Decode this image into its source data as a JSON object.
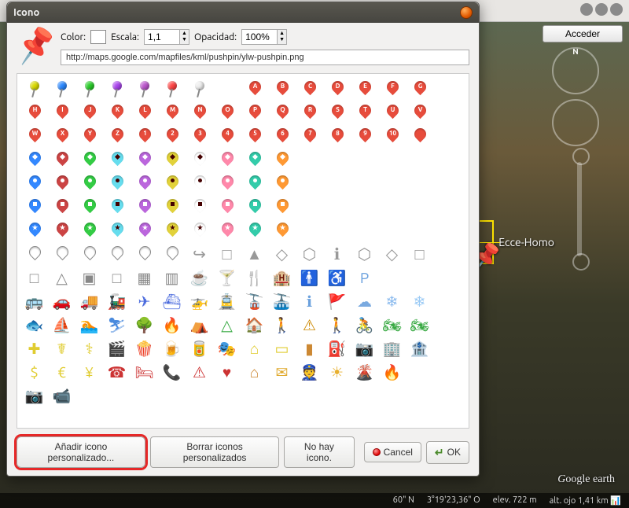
{
  "dialog": {
    "title": "Icono",
    "color_label": "Color:",
    "scale_label": "Escala:",
    "scale_value": "1,1",
    "opacity_label": "Opacidad:",
    "opacity_value": "100%",
    "url_value": "http://maps.google.com/mapfiles/kml/pushpin/ylw-pushpin.png",
    "btn_add_custom": "Añadir icono personalizado...",
    "btn_delete_custom": "Borrar iconos personalizados",
    "btn_no_icon": "No hay icono.",
    "btn_cancel": "Cancel",
    "btn_ok": "OK"
  },
  "icons": {
    "pushpin_colors": [
      "#dada00",
      "#2a88ff",
      "#28cc28",
      "#aa44ee",
      "#bb55cc",
      "#ff4444",
      "#eeeeee"
    ],
    "marker_letters_r1": [
      "A",
      "B",
      "C",
      "D",
      "E",
      "F",
      "G"
    ],
    "marker_letters_r2": [
      "H",
      "I",
      "J",
      "K",
      "L",
      "M",
      "N",
      "O",
      "P",
      "Q",
      "R",
      "S",
      "T",
      "U",
      "V"
    ],
    "marker_letters_r3": [
      "W",
      "X",
      "Y",
      "Z",
      "1",
      "2",
      "3",
      "4",
      "5",
      "6",
      "7",
      "8",
      "9",
      "10",
      ""
    ],
    "paddle_colors": [
      "#3388ff",
      "#cc4444",
      "#33cc44",
      "#66ddee",
      "#bb66dd",
      "#e2d23a",
      "#ffffff",
      "#ff88aa",
      "#33ccaa",
      "#ff9933"
    ],
    "paddle_shapes": [
      "diamond",
      "dot",
      "square",
      "star"
    ],
    "gray_symbols": [
      "↪",
      "□",
      "▲",
      "◇",
      "⬡",
      "ℹ",
      "⬡",
      "◇",
      "□"
    ],
    "poi_row1": [
      "□",
      "△",
      "▣",
      "□",
      "▦",
      "▥",
      "☕",
      "🍸",
      "🍴",
      "🏨",
      "🚹",
      "♿",
      "P"
    ],
    "poi_row2": [
      "🚌",
      "🚗",
      "🚚",
      "🚂",
      "✈",
      "⛴",
      "🚁",
      "🚊",
      "🚡",
      "🚠",
      "ℹ",
      "🚩",
      "☁",
      "❄",
      "❄"
    ],
    "poi_row3": [
      "🐟",
      "⛵",
      "🏊",
      "⛷",
      "🌳",
      "🔥",
      "⛺",
      "△",
      "🏠",
      "🚶",
      "⚠",
      "🚶",
      "🚴",
      "🏍",
      "🏍"
    ],
    "poi_row4": [
      "✚",
      "☤",
      "⚕",
      "🎬",
      "🍿",
      "🍺",
      "🥫",
      "🎭",
      "⌂",
      "▭",
      "▮",
      "⛽",
      "📷",
      "🏢",
      "🏦"
    ],
    "poi_row5": [
      "$",
      "€",
      "¥",
      "☎",
      "🛏",
      "📞",
      "⚠",
      "♥",
      "⌂",
      "✉",
      "👮",
      "☀",
      "🌋",
      "🔥"
    ],
    "poi_row6": [
      "📷",
      "📹"
    ],
    "poi_colors": {
      "row1": [
        "#888",
        "#888",
        "#888",
        "#888",
        "#888",
        "#888",
        "#6aa0dd",
        "#6aa0dd",
        "#6aa0dd",
        "#6aa0dd",
        "#6aa0dd",
        "#6aa0dd",
        "#6aa0dd"
      ],
      "row2": [
        "#4a6add",
        "#4a6add",
        "#4a6add",
        "#4a6add",
        "#4a6add",
        "#4a6add",
        "#4a6add",
        "#4a6add",
        "#4a6add",
        "#4a6add",
        "#6aa0dd",
        "#6aa0dd",
        "#7aaae0",
        "#8abaee",
        "#9acaf5"
      ],
      "row3": [
        "#3a8add",
        "#4a8add",
        "#4a8add",
        "#4a8add",
        "#3aaa44",
        "#3aaa44",
        "#3aaa44",
        "#3aaa44",
        "#3aaa44",
        "#3aaa44",
        "#cc8800",
        "#3aaa44",
        "#3aaa44",
        "#3aaa44",
        "#3aaa44"
      ],
      "row4": [
        "#e0cc30",
        "#e0cc30",
        "#e0cc30",
        "#e0cc30",
        "#e0cc30",
        "#e0cc30",
        "#e0cc30",
        "#e0cc30",
        "#e0cc30",
        "#e0cc30",
        "#cc8833",
        "#e0cc30",
        "#e0cc30",
        "#888",
        "#888"
      ],
      "row5": [
        "#e0cc30",
        "#e0cc30",
        "#e0cc30",
        "#cc3333",
        "#cc3333",
        "#cc3333",
        "#cc3333",
        "#cc3333",
        "#cc8833",
        "#e0aa30",
        "#4a6add",
        "#e8b030",
        "#aa4a20",
        "#dd6622"
      ],
      "row6": [
        "#cc7733",
        "#cc7733"
      ]
    }
  },
  "earth": {
    "acceder": "Acceder",
    "placemark_label": "Ecce-Homo",
    "logo": "Google earth",
    "status": {
      "lat": "60\" N",
      "lon": "3°19'23,36\" O",
      "elev_label": "elev.",
      "elev": "722 m",
      "eye_label": "alt. ojo",
      "eye": "1,41 km"
    }
  }
}
